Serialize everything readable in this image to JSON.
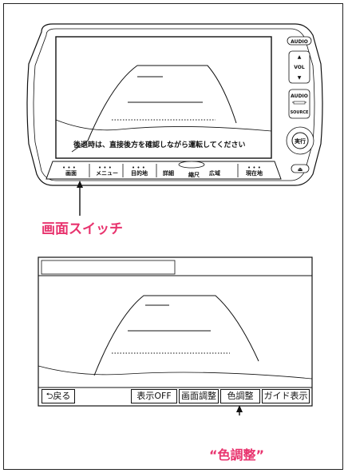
{
  "device": {
    "audio_button": "AUDIO",
    "vol_label": "VOL",
    "audio_source_top": "AUDIO",
    "audio_source_bottom": "SOURCE",
    "enter_button": "実行",
    "eject_symbol": "⏏",
    "screen_message": "後退時は、直接後方を確認しながら運転してください",
    "softkeys": [
      "画面",
      "メニュー",
      "目的地",
      "詳細",
      "縮尺",
      "広域",
      "現在地"
    ]
  },
  "callouts": {
    "screen_switch": "画面スイッチ",
    "color_adjust": "“色調整”"
  },
  "camera_view": {
    "buttons": {
      "back": "戻る",
      "display_off": "表示OFF",
      "screen_adjust": "画面調整",
      "color_adjust": "色調整",
      "guide_display": "ガイド表示"
    }
  }
}
